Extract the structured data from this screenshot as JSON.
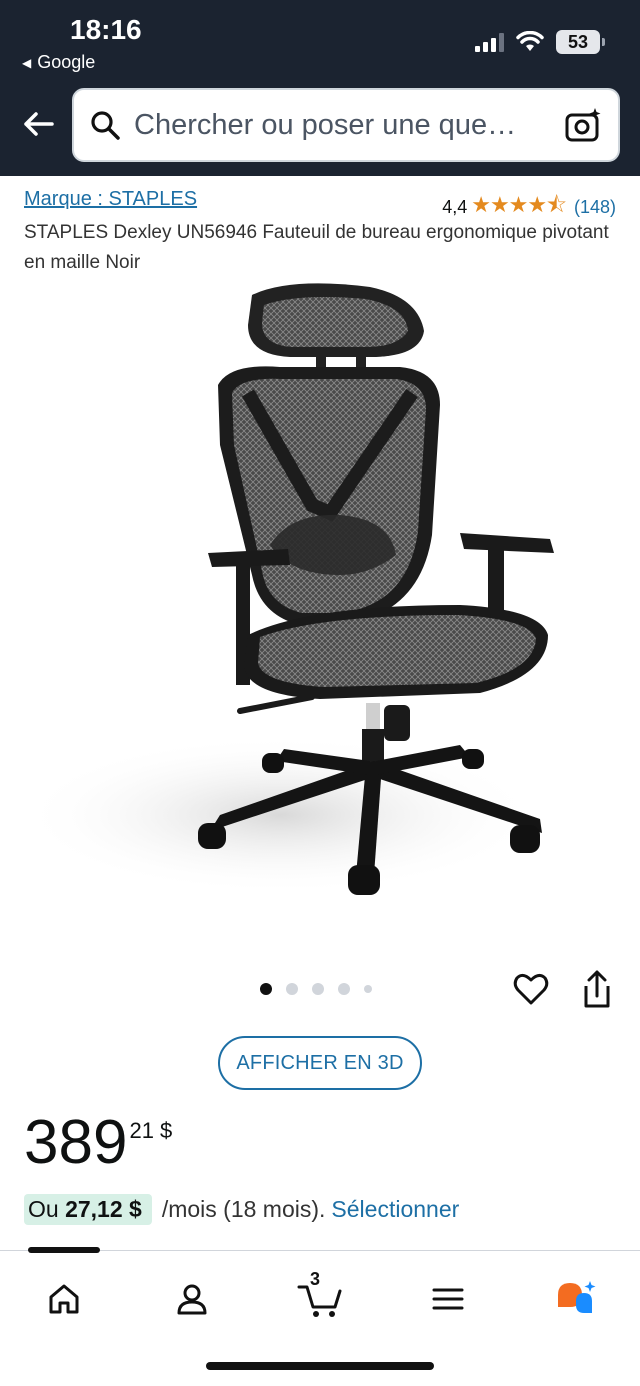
{
  "status_bar": {
    "time": "18:16",
    "back_app": "Google",
    "battery": "53"
  },
  "search": {
    "placeholder": "Chercher ou poser une que…"
  },
  "product": {
    "brand": "Marque : STAPLES",
    "rating": "4,4",
    "stars": "★★★★⯪",
    "star_value": 4.4,
    "review_count": "(148)",
    "title": "STAPLES Dexley UN56946 Fauteuil de bureau ergonomique pivotant en maille Noir"
  },
  "carousel": {
    "total": 5,
    "active_index": 0
  },
  "actions": {
    "view_3d": "AFFICHER EN 3D"
  },
  "price": {
    "whole": "389",
    "cents": "21 $"
  },
  "installment": {
    "prefix": "Ou ",
    "amount": "27,12 $",
    "rest": "/mois (18 mois).",
    "select": "Sélectionner"
  },
  "nav": {
    "cart_count": "3"
  },
  "colors": {
    "header_bg": "#1b2330",
    "link": "#1d6fa5",
    "star": "#e48a1f",
    "installment_bg": "#d7f0e6"
  }
}
